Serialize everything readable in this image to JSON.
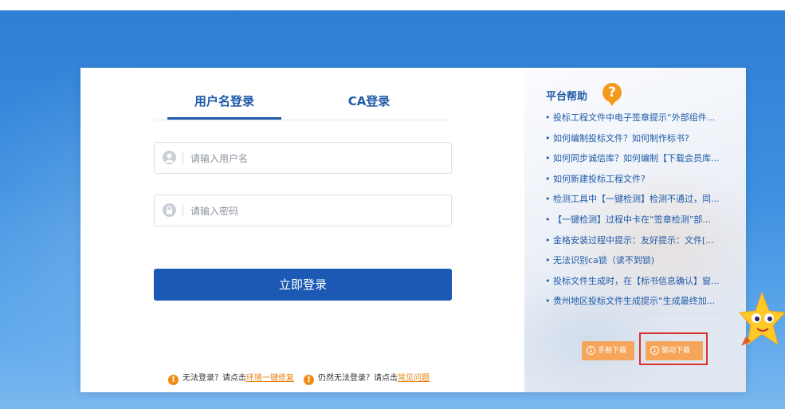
{
  "login": {
    "tabs": [
      {
        "label": "用户名登录"
      },
      {
        "label": "CA登录"
      }
    ],
    "username_placeholder": "请输入用户名",
    "password_placeholder": "请输入密码",
    "submit_label": "立即登录",
    "tips": {
      "part1": "无法登录？请点击",
      "link1": "环境一键修复",
      "part2": "仍然无法登录？请点击",
      "link2": "常见问题"
    }
  },
  "help": {
    "title": "平台帮助",
    "items": [
      "投标工程文件中电子签章提示“外部组件...",
      "如何编制投标文件？如何制作标书?",
      "如何同步诚信库？如何编制【下载会员库...",
      "如何新建投标工程文件?",
      "检测工具中【一键检测】检测不通过，同...",
      "【一键检测】过程中卡在“签章检测”部...",
      "金格安装过程中提示：友好提示：文件[...",
      "无法识别ca锁（读不到锁)",
      "投标文件生成时，在【标书信息确认】窗...",
      "贵州地区投标文件生成提示“生成最终加..."
    ],
    "manual_download": "手册下载",
    "driver_download": "驱动下载"
  },
  "colors": {
    "primary": "#1b59b4",
    "link": "#1f5aa8",
    "warning": "#f08c14",
    "download_button": "#f5a65a",
    "highlight_box": "#d9322a"
  }
}
